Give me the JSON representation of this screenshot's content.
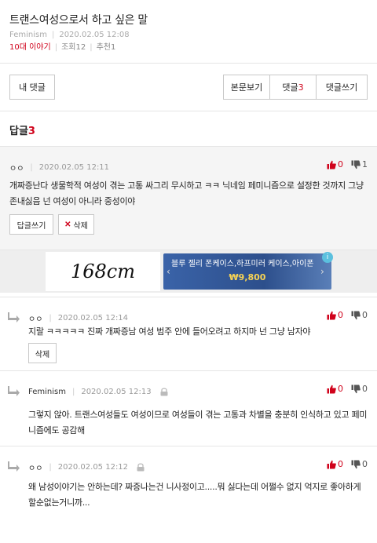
{
  "post": {
    "title": "트랜스여성으로서 하고 싶은 말",
    "author": "Feminism",
    "date": "2020.02.05 12:08",
    "board": "10대 이야기",
    "views": "조회12",
    "recommend": "추천1"
  },
  "toolbar": {
    "my_comments": "내 댓글",
    "view_post": "본문보기",
    "comments_label": "댓글",
    "comments_count": "3",
    "write_comment": "댓글쓰기"
  },
  "replies": {
    "label": "답글",
    "count": "3"
  },
  "comments": [
    {
      "nick": "ㅇㅇ",
      "date": "2020.02.05 12:11",
      "up": "0",
      "down": "1",
      "text": "개짜증난다 생물학적 여성이 겪는 고통 싸그리 무시하고 ㅋㅋ 닉네임 페미니즘으로 설정한 것까지 그냥 존내싫음 넌 여성이 아니라 중성이야",
      "reply_btn": "답글쓰기",
      "delete_btn": "삭제"
    },
    {
      "nick": "ㅇㅇ",
      "date": "2020.02.05 12:14",
      "up": "0",
      "down": "0",
      "text": "지랄 ㅋㅋㅋㅋㅋ 진짜 개짜증남 여성 범주 안에 들어오려고 하지마 넌 그냥 남자야",
      "delete_btn": "삭제"
    },
    {
      "nick": "Feminism",
      "date": "2020.02.05 12:13",
      "up": "0",
      "down": "0",
      "text": "그렇지 않아. 트랜스여성들도 여성이므로 여성들이 겪는 고통과 차별을 충분히 인식하고 있고 페미니즘에도 공감해"
    },
    {
      "nick": "ㅇㅇ",
      "date": "2020.02.05 12:12",
      "up": "0",
      "down": "0",
      "text": "왜 남성이야기는 안하는데? 짜증나는건 니사정이고.....뭐 싫다는데 어쩔수 없지 억지로 좋아하게 할순없는거니까..."
    }
  ],
  "ad": {
    "left_text": "168cm",
    "right_text": "블루 젤리 폰케이스,하프미러 케이스,아이폰",
    "price": "₩9,800",
    "info": "i"
  },
  "colors": {
    "accent": "#d0021b",
    "border": "#c8c8c8",
    "gray_bg": "#f5f5f5"
  }
}
